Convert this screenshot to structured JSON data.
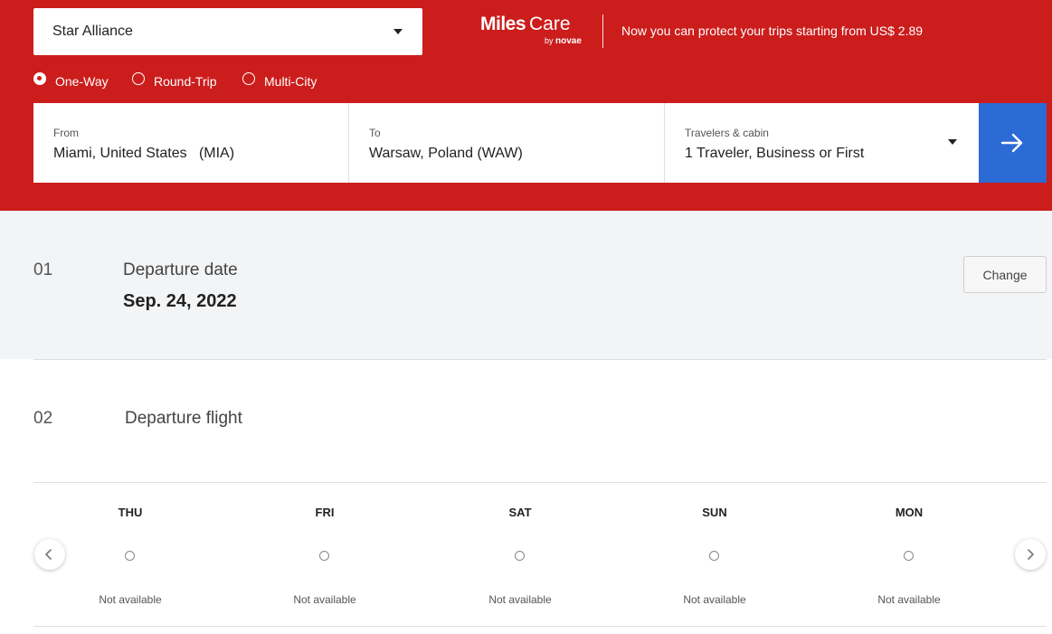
{
  "header": {
    "alliance": "Star Alliance",
    "brand": {
      "miles": "Miles",
      "care": "Care",
      "by": "by",
      "novae": "novae"
    },
    "promo": "Now you can protect your trips starting from US$ 2.89",
    "trip_types": [
      {
        "label": "One-Way",
        "checked": true
      },
      {
        "label": "Round-Trip",
        "checked": false
      },
      {
        "label": "Multi-City",
        "checked": false
      }
    ]
  },
  "search": {
    "from_label": "From",
    "from_value": "Miami, United States   (MIA)",
    "to_label": "To",
    "to_value": "Warsaw, Poland (WAW)",
    "travelers_label": "Travelers & cabin",
    "travelers_value": "1 Traveler, Business or First"
  },
  "steps": {
    "departure_date": {
      "num": "01",
      "title": "Departure date",
      "value": "Sep. 24, 2022",
      "change_label": "Change"
    },
    "departure_flight": {
      "num": "02",
      "title": "Departure flight"
    }
  },
  "calendar": {
    "days": [
      {
        "name": "THU",
        "status": "Not available"
      },
      {
        "name": "FRI",
        "status": "Not available"
      },
      {
        "name": "SAT",
        "status": "Not available"
      },
      {
        "name": "SUN",
        "status": "Not available"
      },
      {
        "name": "MON",
        "status": "Not available"
      }
    ]
  },
  "colors": {
    "brand_red": "#cc1d1d",
    "action_blue": "#2c6ad6",
    "section_gray": "#f3f4f6"
  }
}
